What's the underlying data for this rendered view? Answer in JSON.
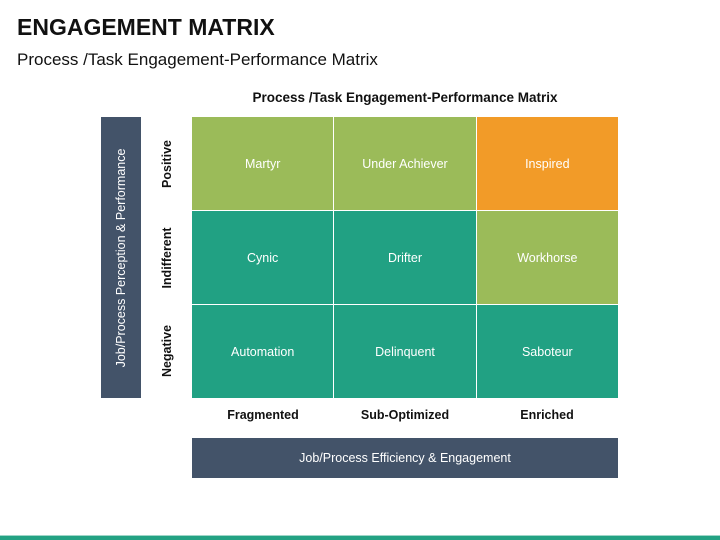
{
  "header": {
    "title": "ENGAGEMENT MATRIX",
    "subtitle": "Process /Task Engagement-Performance Matrix"
  },
  "matrix": {
    "title": "Process /Task Engagement-Performance Matrix",
    "y_axis_label": "Job/Process Perception & Performance",
    "x_axis_label": "Job/Process Efficiency & Engagement",
    "row_labels": [
      "Positive",
      "Indifferent",
      "Negative"
    ],
    "column_labels": [
      "Fragmented",
      "Sub-Optimized",
      "Enriched"
    ],
    "rows": [
      [
        {
          "label": "Martyr",
          "color": "#9bbb59"
        },
        {
          "label": "Under Achiever",
          "color": "#9bbb59"
        },
        {
          "label": "Inspired",
          "color": "#f29b28"
        }
      ],
      [
        {
          "label": "Cynic",
          "color": "#21a183"
        },
        {
          "label": "Drifter",
          "color": "#21a183"
        },
        {
          "label": "Workhorse",
          "color": "#9bbb59"
        }
      ],
      [
        {
          "label": "Automation",
          "color": "#21a183"
        },
        {
          "label": "Delinquent",
          "color": "#21a183"
        },
        {
          "label": "Saboteur",
          "color": "#21a183"
        }
      ]
    ]
  },
  "colors": {
    "axis_bar": "#435369",
    "green": "#9bbb59",
    "teal": "#21a183",
    "orange": "#f29b28"
  }
}
